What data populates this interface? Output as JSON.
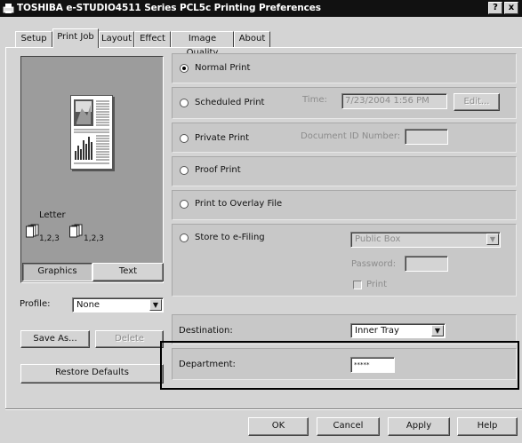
{
  "window": {
    "title": "TOSHIBA e-STUDIO4511 Series PCL5c Printing Preferences",
    "help_button": "?",
    "close_button": "x"
  },
  "tabs": [
    {
      "label": "Setup",
      "active": false
    },
    {
      "label": "Print Job",
      "active": true
    },
    {
      "label": "Layout",
      "active": false
    },
    {
      "label": "Effect",
      "active": false
    },
    {
      "label": "Image Quality",
      "active": false
    },
    {
      "label": "About",
      "active": false
    }
  ],
  "preview": {
    "paper_size": "Letter",
    "collate_1": "1,2,3",
    "collate_2": "1,2,3",
    "graphics_label": "Graphics",
    "text_label": "Text"
  },
  "profile": {
    "label": "Profile:",
    "value": "None",
    "save_as_label": "Save As...",
    "delete_label": "Delete",
    "restore_label": "Restore Defaults"
  },
  "print_options": {
    "normal": "Normal Print",
    "scheduled": "Scheduled Print",
    "time_label": "Time:",
    "time_value": "7/23/2004 1:56 PM",
    "edit_label": "Edit...",
    "private": "Private Print",
    "doc_id_label": "Document ID Number:",
    "doc_id_value": "",
    "proof": "Proof Print",
    "overlay": "Print to Overlay File",
    "efiling": "Store to e-Filing",
    "box_value": "Public Box",
    "password_label": "Password:",
    "password_value": "",
    "print_check": "Print",
    "selected": "normal"
  },
  "destination": {
    "label": "Destination:",
    "value": "Inner Tray"
  },
  "department": {
    "label": "Department:",
    "value": "*****"
  },
  "footer": {
    "ok": "OK",
    "cancel": "Cancel",
    "apply": "Apply",
    "help": "Help"
  },
  "colors": {
    "dialog_bg": "#d4d4d4",
    "title_bar": "#111111",
    "preview_bg": "#9c9c9c"
  }
}
